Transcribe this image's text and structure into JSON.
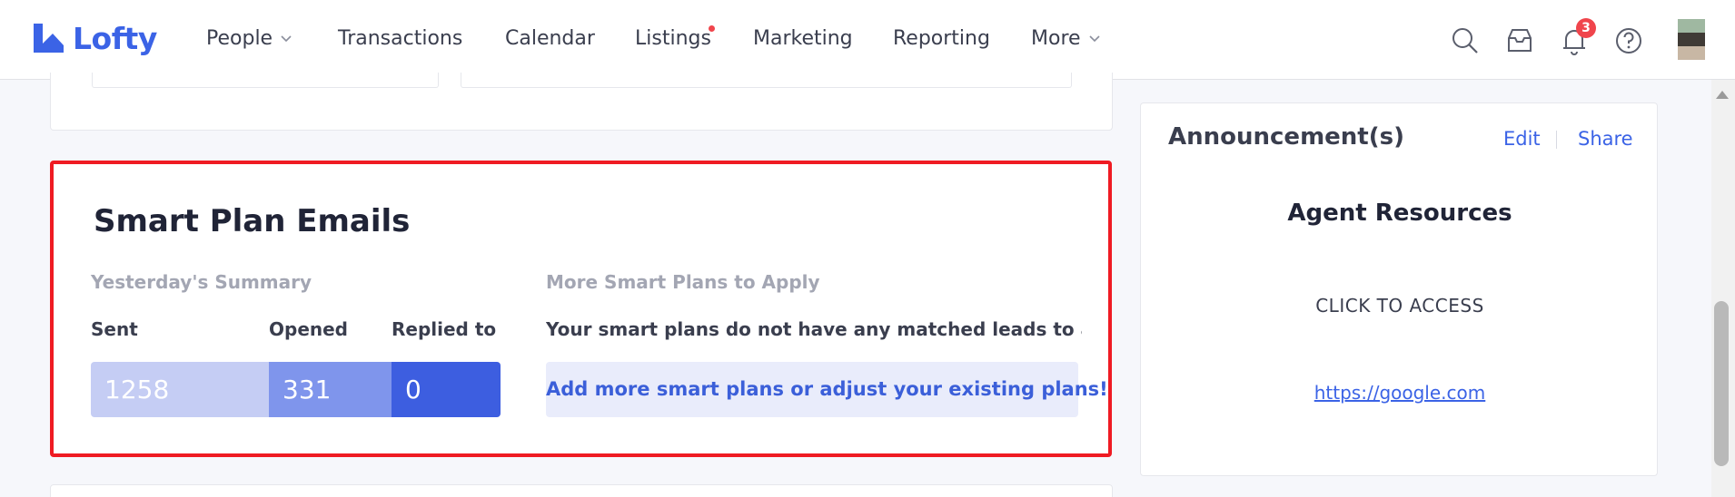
{
  "app": {
    "name": "Lofty",
    "logo_icon": "lofty-logo-icon"
  },
  "nav": {
    "items": [
      {
        "label": "People",
        "has_dropdown": true
      },
      {
        "label": "Transactions"
      },
      {
        "label": "Calendar"
      },
      {
        "label": "Listings",
        "has_dot": true
      },
      {
        "label": "Marketing"
      },
      {
        "label": "Reporting"
      },
      {
        "label": "More",
        "has_dropdown": true
      }
    ],
    "tools": [
      "search-icon",
      "inbox-icon",
      "bell-icon",
      "help-icon"
    ],
    "notification_count": "3"
  },
  "smart_plan": {
    "title": "Smart Plan Emails",
    "summary_heading": "Yesterday's Summary",
    "stats": [
      {
        "label": "Sent",
        "value": "1258",
        "color": "#c5cdf4"
      },
      {
        "label": "Opened",
        "value": "331",
        "color": "#7f95ec"
      },
      {
        "label": "Replied to",
        "value": "0",
        "color": "#3d5ee0"
      }
    ],
    "more_heading": "More Smart Plans to Apply",
    "no_match_text": "Your smart plans do not have any matched leads to app...",
    "add_more_label": "Add more smart plans or adjust your existing plans!"
  },
  "announcement": {
    "title": "Announcement(s)",
    "edit_label": "Edit",
    "share_label": "Share",
    "heading": "Agent Resources",
    "cta": "CLICK TO ACCESS",
    "link": "https://google.com"
  },
  "colors": {
    "accent": "#3b63e6",
    "highlight_border": "#ef1b23",
    "badge": "#f0454c"
  }
}
